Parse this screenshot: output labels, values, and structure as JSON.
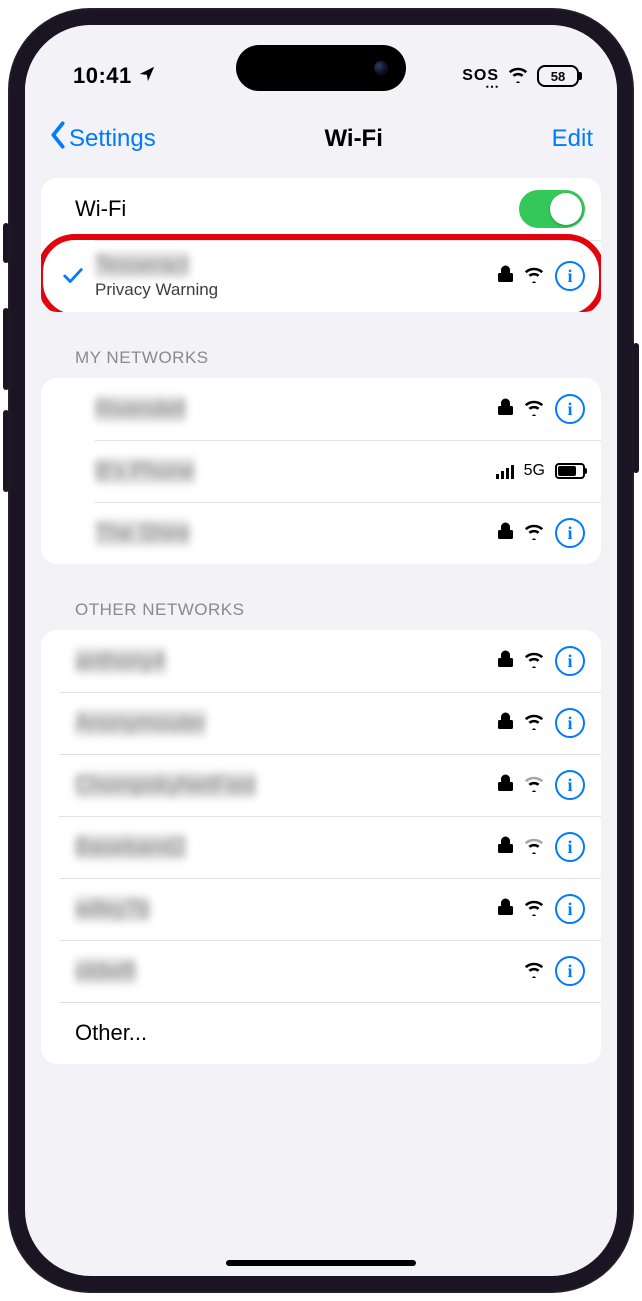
{
  "status": {
    "time": "10:41",
    "sos": "SOS",
    "battery_pct": "58"
  },
  "nav": {
    "back_label": "Settings",
    "title": "Wi-Fi",
    "edit_label": "Edit"
  },
  "wifi_toggle": {
    "label": "Wi-Fi",
    "on": true
  },
  "connected": {
    "name": "Tesseract",
    "subtitle": "Privacy Warning",
    "locked": true
  },
  "sections": {
    "my_networks_header": "MY NETWORKS",
    "other_networks_header": "OTHER NETWORKS",
    "other_label": "Other..."
  },
  "my_networks": [
    {
      "name": "Rivendell",
      "locked": true,
      "type": "wifi"
    },
    {
      "name": "B's Phone",
      "locked": false,
      "type": "hotspot",
      "tech": "5G"
    },
    {
      "name": "The Shire",
      "locked": true,
      "type": "wifi"
    }
  ],
  "other_networks": [
    {
      "name": "anthony4",
      "locked": true,
      "strong": true
    },
    {
      "name": "Anonymouter",
      "locked": true,
      "strong": true
    },
    {
      "name": "ChompskyNetFast",
      "locked": true,
      "strong": false
    },
    {
      "name": "Baseband2",
      "locked": true,
      "strong": false
    },
    {
      "name": "wifey7b",
      "locked": true,
      "strong": true
    },
    {
      "name": "oldwifi",
      "locked": false,
      "strong": true
    }
  ],
  "icons": {
    "location": "location-icon",
    "wifi": "wifi-icon",
    "lock": "lock-icon",
    "info": "info-icon",
    "check": "check-icon",
    "chevron_left": "chevron-left-icon"
  },
  "colors": {
    "accent_blue": "#007aff",
    "toggle_green": "#34c759",
    "bg": "#f2f2f7",
    "highlight_red": "#e3030c"
  }
}
